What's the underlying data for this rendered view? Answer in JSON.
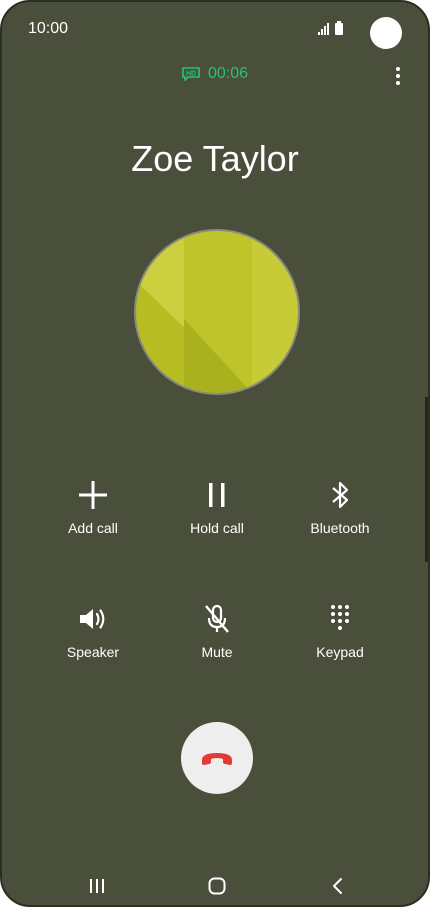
{
  "status_bar": {
    "time": "10:00",
    "icons": [
      "signal-icon",
      "battery-icon"
    ]
  },
  "call": {
    "hd_icon": "hd-voice-icon",
    "timer": "00:06",
    "timer_color": "#24c37a",
    "contact_name": "Zoe Taylor",
    "avatar_color": "#c7cc33"
  },
  "controls": [
    {
      "label": "Add call",
      "icon": "add-icon"
    },
    {
      "label": "Hold call",
      "icon": "pause-icon"
    },
    {
      "label": "Bluetooth",
      "icon": "bluetooth-icon"
    },
    {
      "label": "Speaker",
      "icon": "speaker-icon"
    },
    {
      "label": "Mute",
      "icon": "mute-microphone-icon"
    },
    {
      "label": "Keypad",
      "icon": "keypad-icon"
    }
  ],
  "end_call": {
    "icon": "end-call-icon",
    "color": "#e53935"
  },
  "nav_bar": {
    "items": [
      "recent-apps-icon",
      "home-icon",
      "back-icon"
    ]
  },
  "colors": {
    "background": "#4a4f3c"
  }
}
